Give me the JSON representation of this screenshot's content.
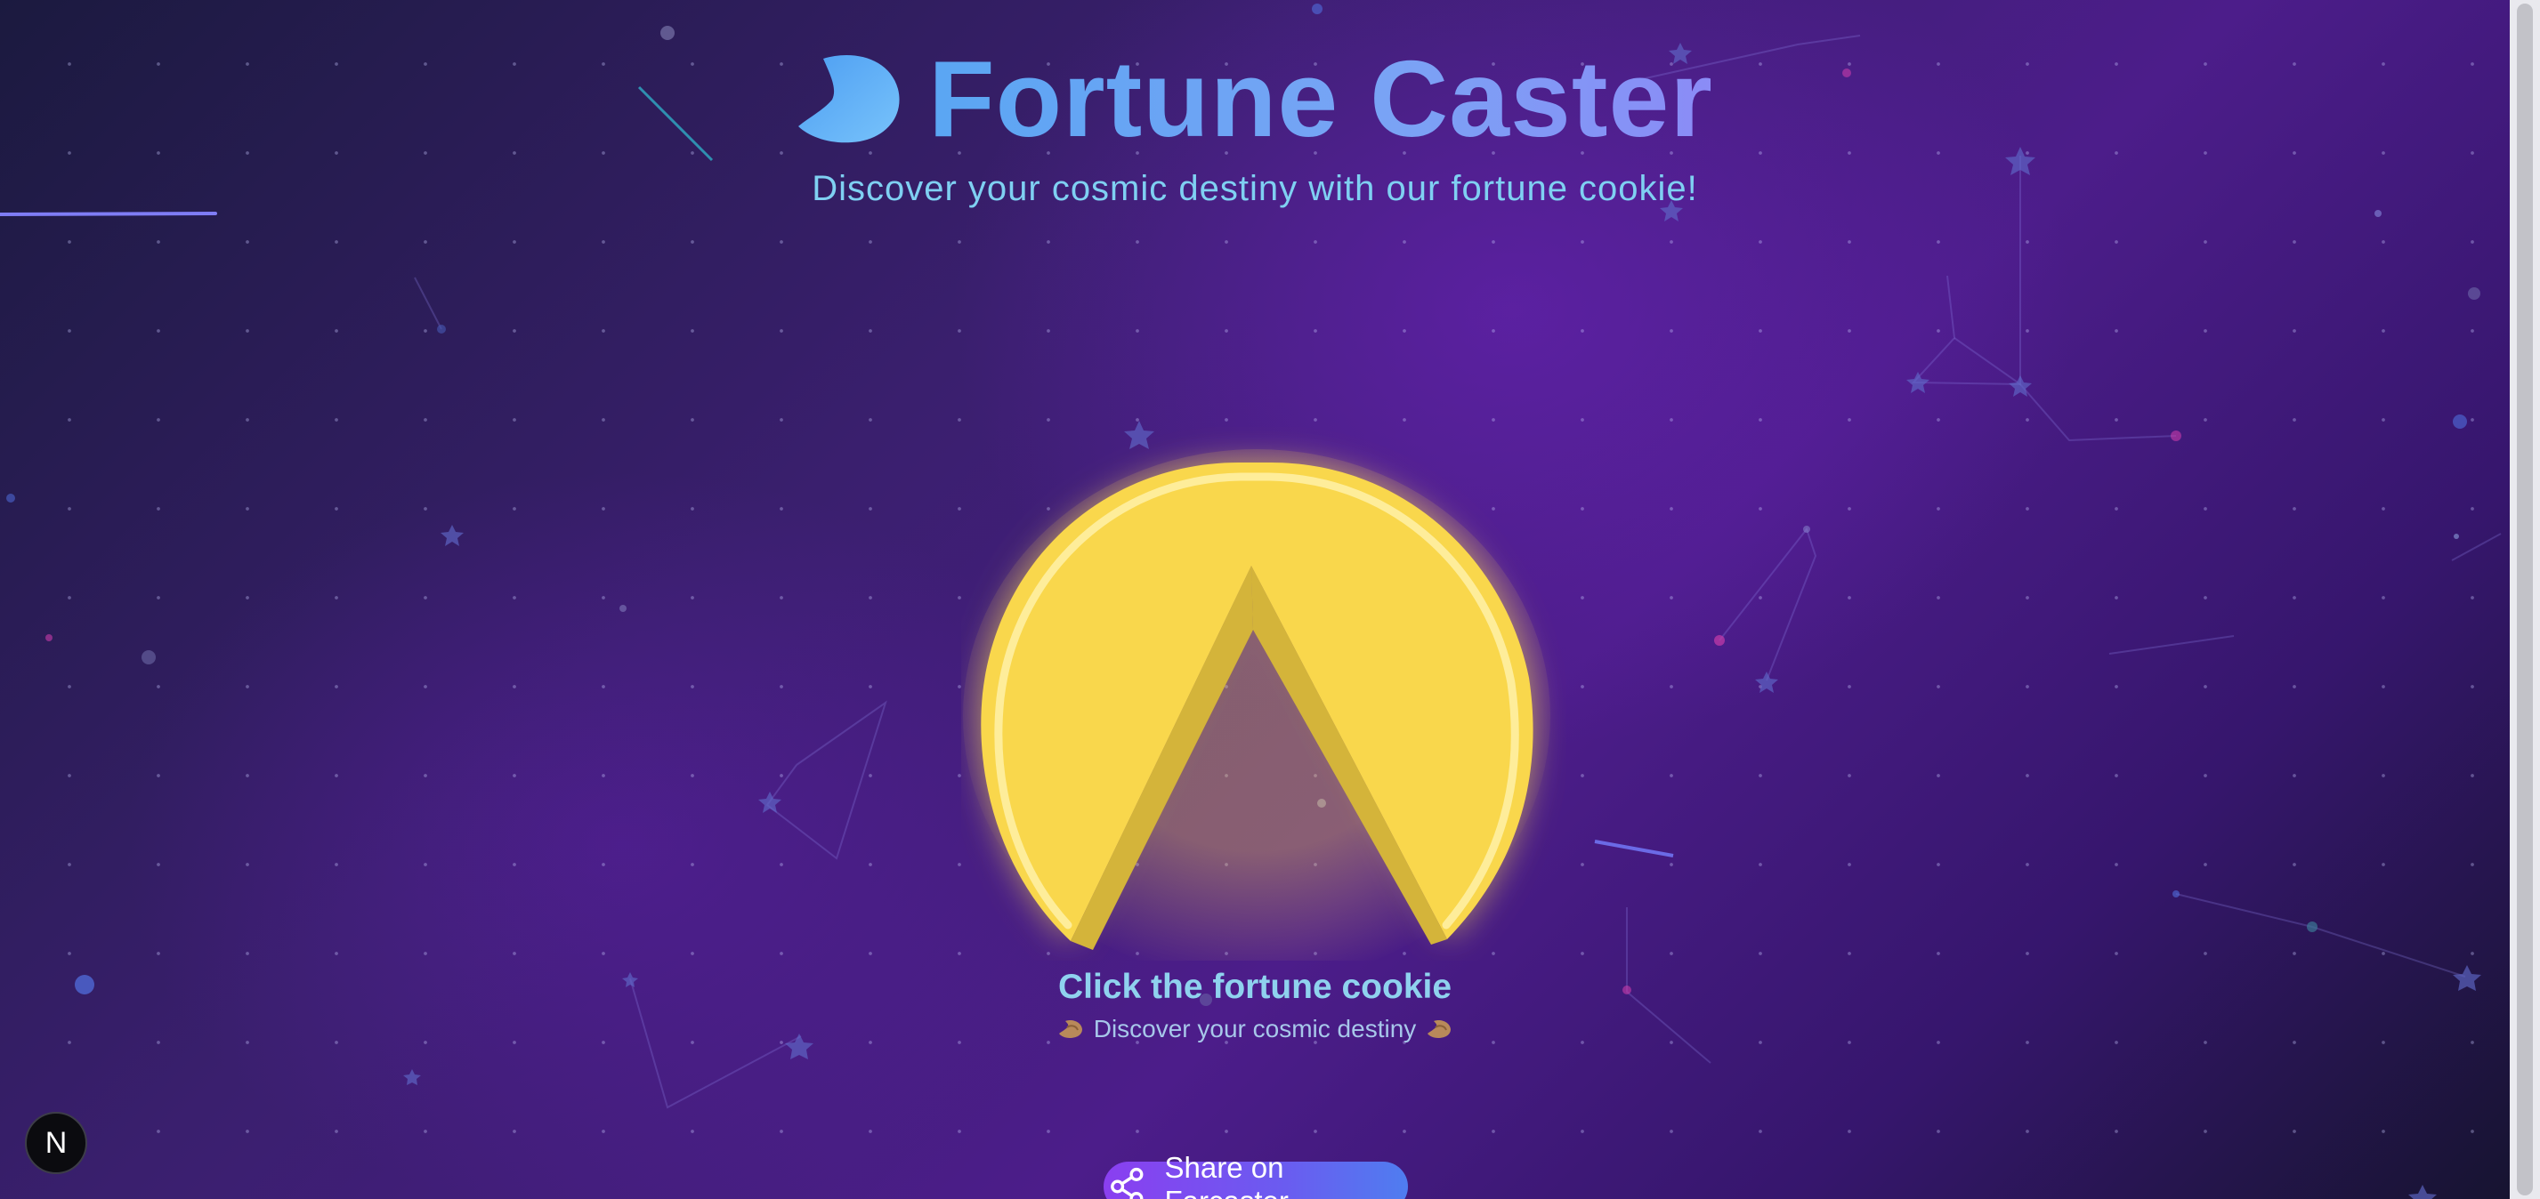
{
  "header": {
    "title": "Fortune Caster",
    "subtitle": "Discover your cosmic destiny with our fortune cookie!",
    "logo_icon": "fortune-cookie-icon"
  },
  "cookie": {
    "icon": "fortune-cookie-icon",
    "color": "#f9d74c"
  },
  "hint": {
    "title": "Click the fortune cookie",
    "subtitle": "Discover your cosmic destiny",
    "icon": "fortune-cookie-icon"
  },
  "share": {
    "label": "Share on Farcaster",
    "icon": "share-icon"
  },
  "dev_badge": {
    "letter": "N"
  },
  "colors": {
    "title_gradient_start": "#5aa6f3",
    "title_gradient_end": "#8b8bf6",
    "subtitle": "#7fd0f2",
    "share_gradient_start": "#8a3ff0",
    "share_gradient_end": "#4f7df0"
  }
}
